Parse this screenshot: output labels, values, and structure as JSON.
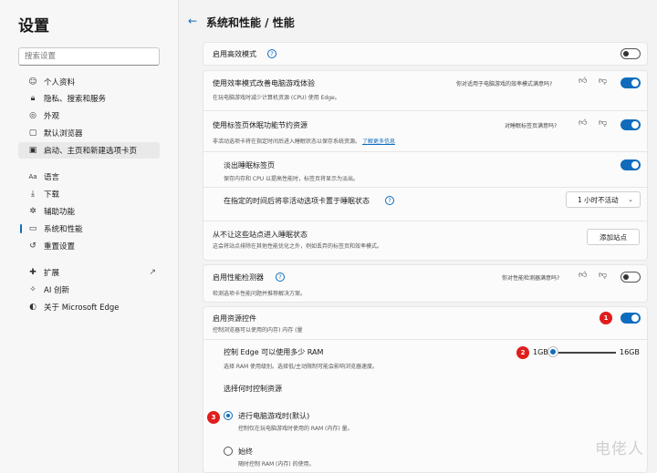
{
  "sidebar": {
    "title": "设置",
    "search_placeholder": "搜索设置",
    "items": [
      {
        "label": "个人资料",
        "icon": "profile-icon",
        "glyph": "☺"
      },
      {
        "label": "隐私、搜索和服务",
        "icon": "lock-icon",
        "glyph": "🔒︎"
      },
      {
        "label": "外观",
        "icon": "palette-icon",
        "glyph": "◎"
      },
      {
        "label": "默认浏览器",
        "icon": "browser-icon",
        "glyph": "▢"
      },
      {
        "label": "启动、主页和新建选项卡页",
        "icon": "home-tab-icon",
        "glyph": "▣"
      },
      {
        "label": "语言",
        "icon": "language-icon",
        "glyph": "Aa"
      },
      {
        "label": "下载",
        "icon": "download-icon",
        "glyph": "⤓"
      },
      {
        "label": "辅助功能",
        "icon": "accessibility-icon",
        "glyph": "✲"
      },
      {
        "label": "系统和性能",
        "icon": "system-icon",
        "glyph": "▭"
      },
      {
        "label": "重置设置",
        "icon": "reset-icon",
        "glyph": "↺"
      },
      {
        "label": "扩展",
        "icon": "extensions-icon",
        "glyph": "✚"
      },
      {
        "label": "AI 创新",
        "icon": "ai-icon",
        "glyph": "✧"
      },
      {
        "label": "关于 Microsoft Edge",
        "icon": "edge-icon",
        "glyph": "◐"
      }
    ]
  },
  "header": {
    "title": "系统和性能 / 性能"
  },
  "efficiency_mode": {
    "label": "启用高效模式",
    "enabled": false
  },
  "gaming": {
    "label": "使用效率模式改善电脑游戏体验",
    "desc": "在玩电脑游戏时减少计算机资源 (CPU) 使用 Edge。",
    "feedback": "你对适用于电脑游戏的效率模式满意吗?",
    "enabled": true
  },
  "sleeping_tabs": {
    "label": "使用标签页休眠功能节约资源",
    "desc": "非活动选项卡将在指定时间后进入睡眠状态以保存系统资源。",
    "link": "了解更多信息",
    "feedback": "对睡眠标签页满意吗?",
    "enabled": true
  },
  "fade_tabs": {
    "label": "淡出睡眠标签页",
    "desc": "保存内存和 CPU 以提高性能时，标签页将显示为淡出。",
    "enabled": true
  },
  "sleep_after": {
    "label": "在指定的时间后将非活动选项卡置于睡眠状态",
    "value": "1 小时不活动"
  },
  "never_sleep": {
    "label": "从不让这些站点进入睡眠状态",
    "desc": "这会将站点排除在其他性能优化之外，例如丢弃的标签页和效率模式。",
    "button": "添加站点"
  },
  "perf_detector": {
    "label": "启用性能检测器",
    "desc": "检测选项卡性能问题并推荐解决方案。",
    "feedback": "你对性能检测器满意吗?",
    "enabled": false
  },
  "resource_controls": {
    "label": "启用资源控件",
    "desc": "控制浏览器可以使用的内存) 内存 (量",
    "enabled": true,
    "badge": "1"
  },
  "ram_limit": {
    "label": "控制 Edge 可以使用多少 RAM",
    "desc": "选择 RAM 使用级别。选择低/主动限制可能会影响浏览器速度。",
    "min_label": "1GB",
    "max_label": "16GB",
    "value_fraction": 0.0,
    "badge": "2"
  },
  "when_control": {
    "label": "选择何时控制资源"
  },
  "options": [
    {
      "label": "进行电脑游戏时(默认)",
      "desc": "控制仅在玩电脑游戏时使用的 RAM (内存) 量。",
      "checked": true,
      "badge": "3"
    },
    {
      "label": "始终",
      "desc": "随时控制 RAM (内存) 的使用。",
      "checked": false
    }
  ],
  "watermark": "电佬人",
  "colors": {
    "accent": "#0f6cbd",
    "badge": "#e01d1d"
  }
}
